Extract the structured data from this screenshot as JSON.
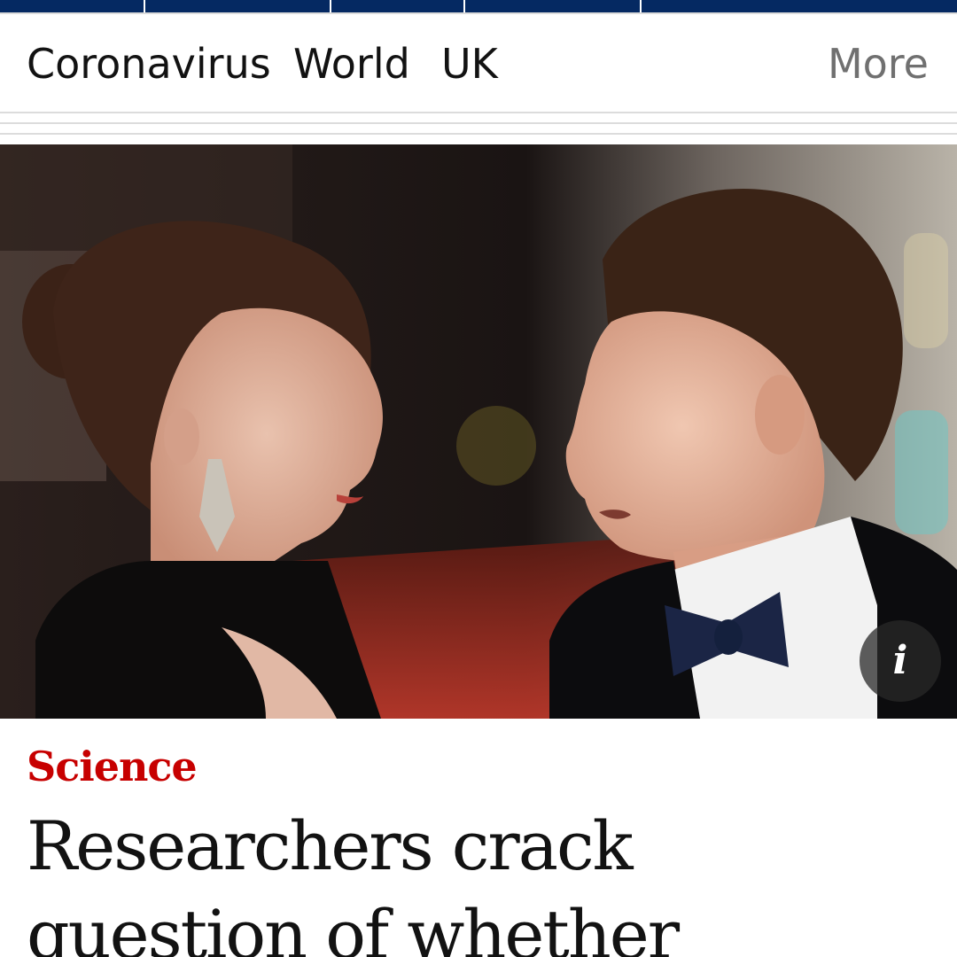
{
  "nav": {
    "items": [
      {
        "label": "Coronavirus"
      },
      {
        "label": "World"
      },
      {
        "label": "UK"
      }
    ],
    "more_label": "More"
  },
  "hero": {
    "info_icon_glyph": "i",
    "icon": "info-icon"
  },
  "article": {
    "section": "Science",
    "headline_line1": "Researchers crack",
    "headline_line2": "question of whether"
  },
  "colors": {
    "brand_navy": "#052962",
    "section_red": "#c70000",
    "text": "#121212",
    "muted": "#707070"
  }
}
